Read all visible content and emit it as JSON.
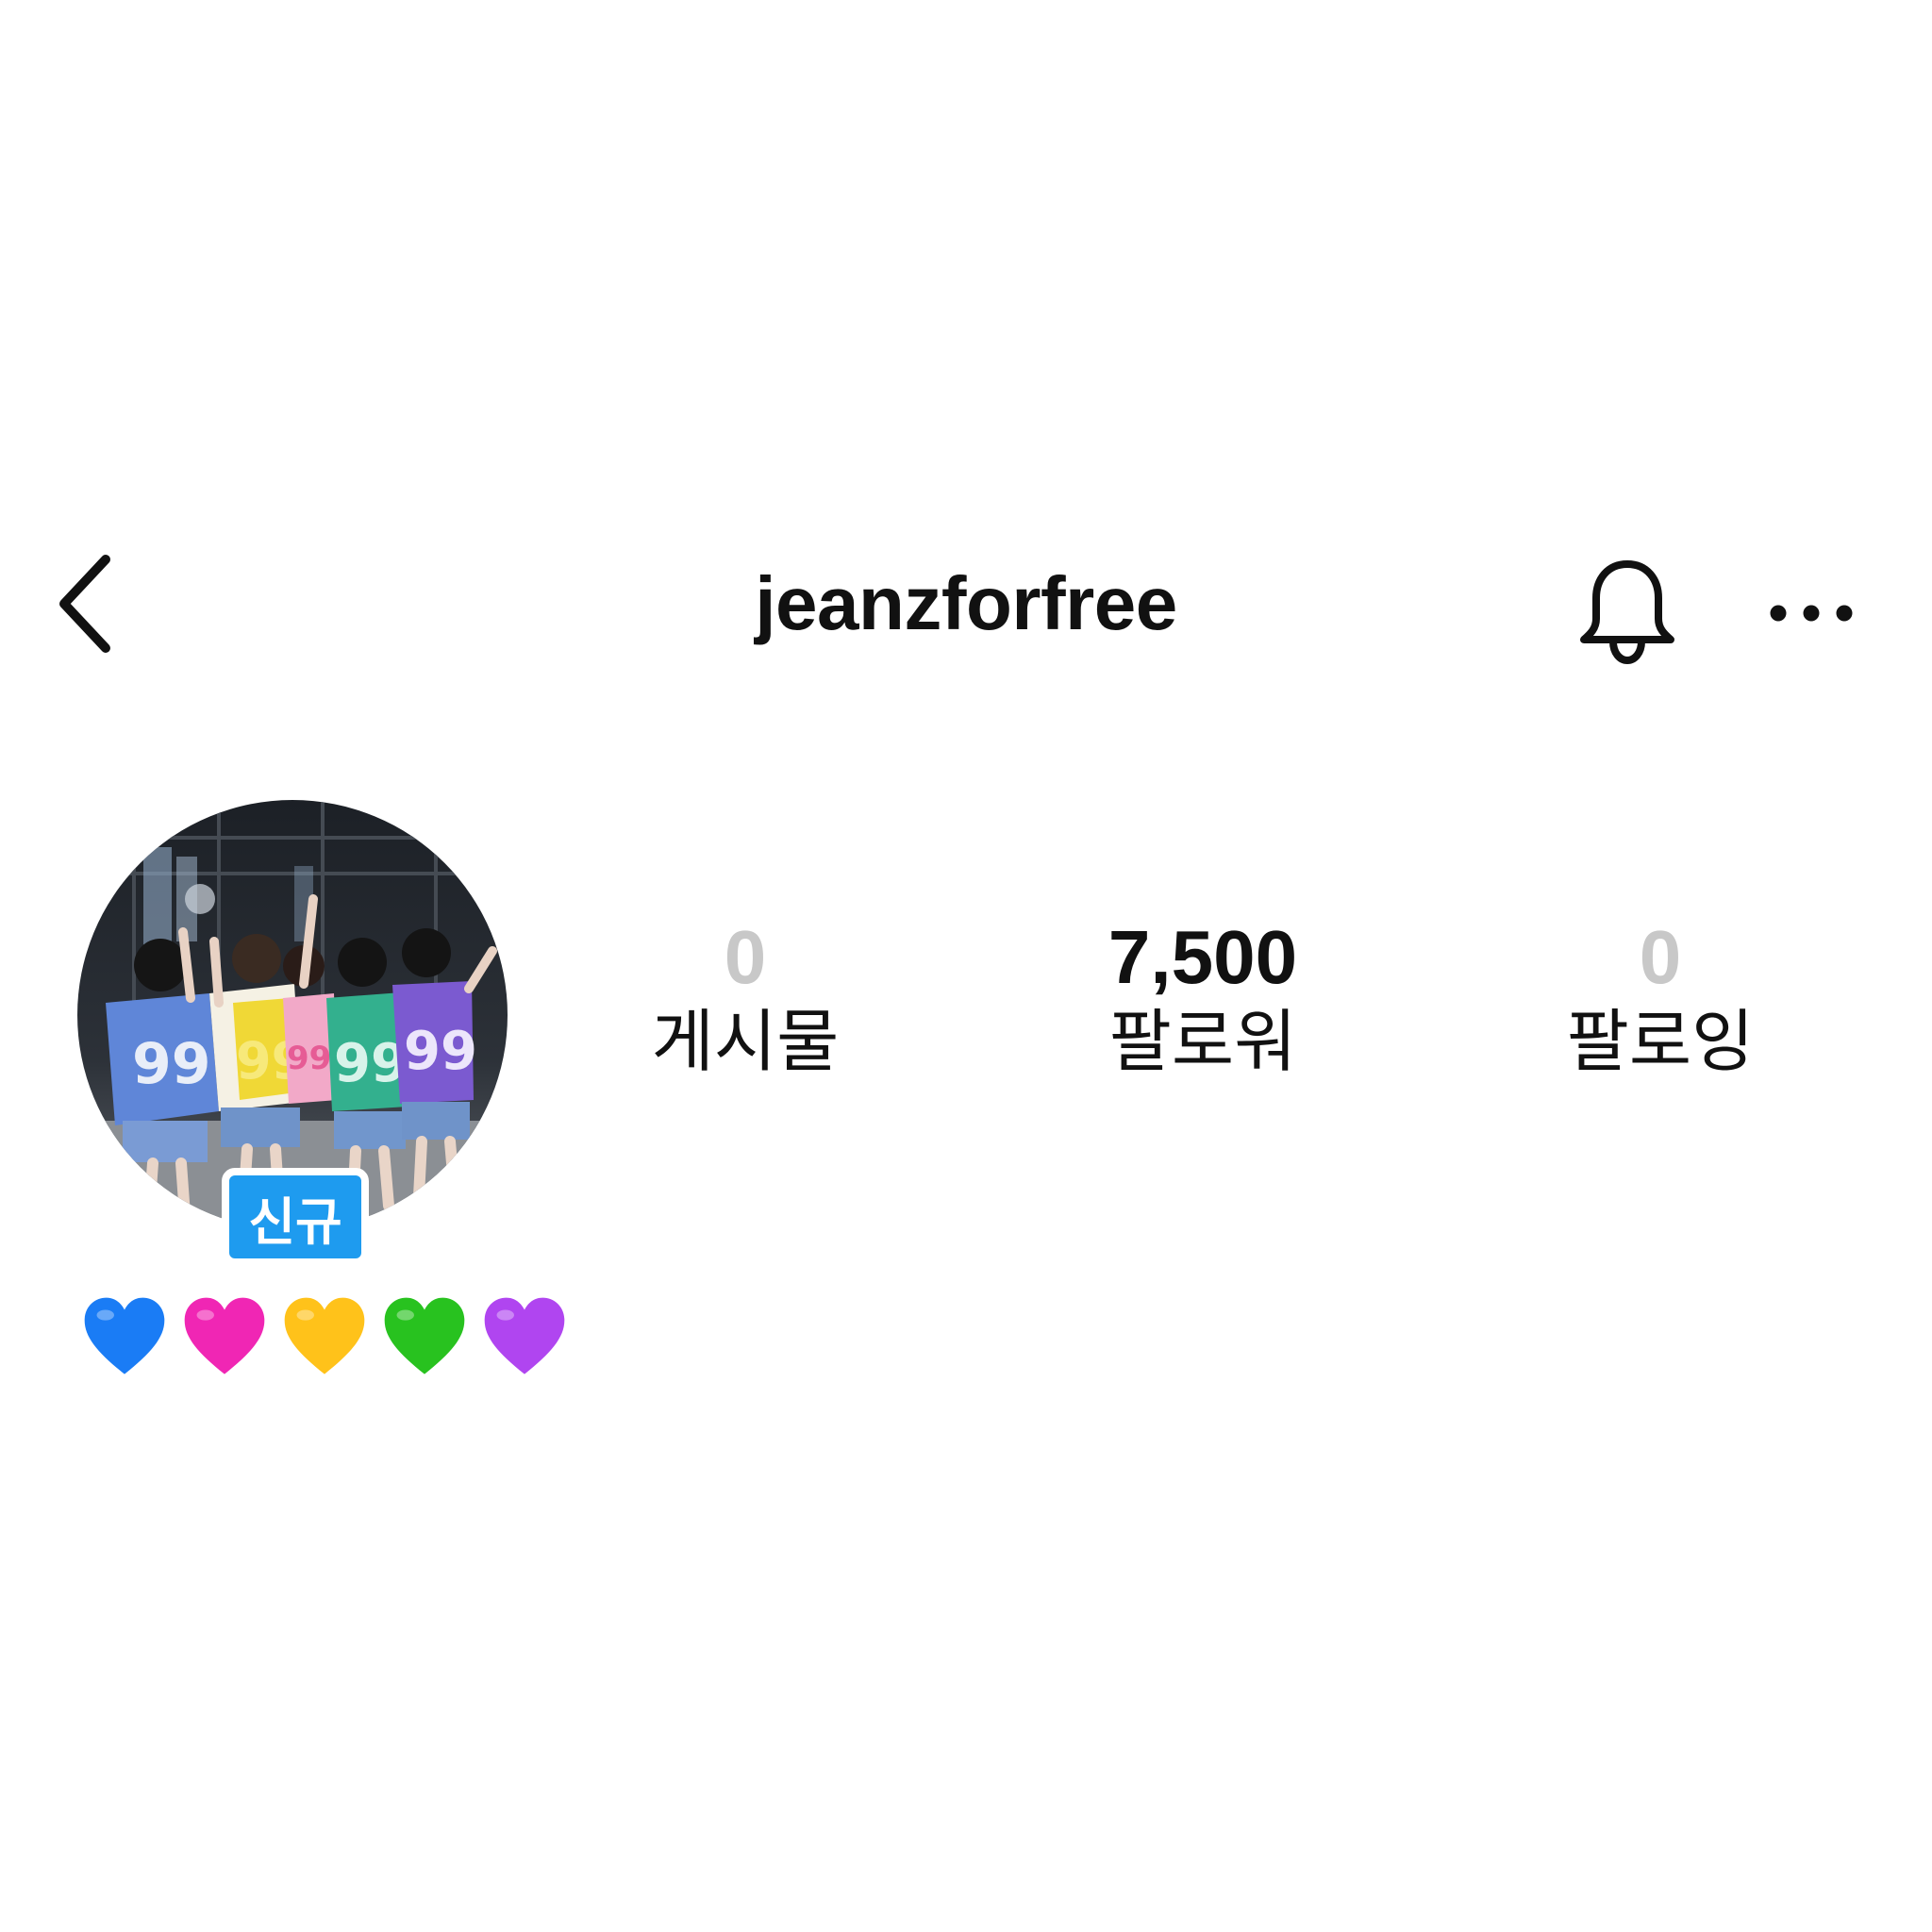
{
  "header": {
    "username": "jeanzforfree",
    "back_icon": "chevron-left-icon",
    "bell_icon": "bell-icon",
    "more_icon": "more-horizontal-icon"
  },
  "profile": {
    "badge_label": "신규",
    "badge_color": "#1e9bef",
    "bio_hearts": [
      "blue-heart-icon",
      "pink-heart-icon",
      "yellow-heart-icon",
      "green-heart-icon",
      "purple-heart-icon"
    ]
  },
  "stats": {
    "posts": {
      "count": "0",
      "label": "게시물"
    },
    "followers": {
      "count": "7,500",
      "label": "팔로워"
    },
    "following": {
      "count": "0",
      "label": "팔로잉"
    }
  },
  "colors": {
    "text": "#111111",
    "zero_count": "#c8c8c8",
    "heart_blue": "#1a7cf5",
    "heart_pink": "#f026b4",
    "heart_yellow": "#ffc21a",
    "heart_green": "#28c21f",
    "heart_purple": "#b045f0"
  }
}
